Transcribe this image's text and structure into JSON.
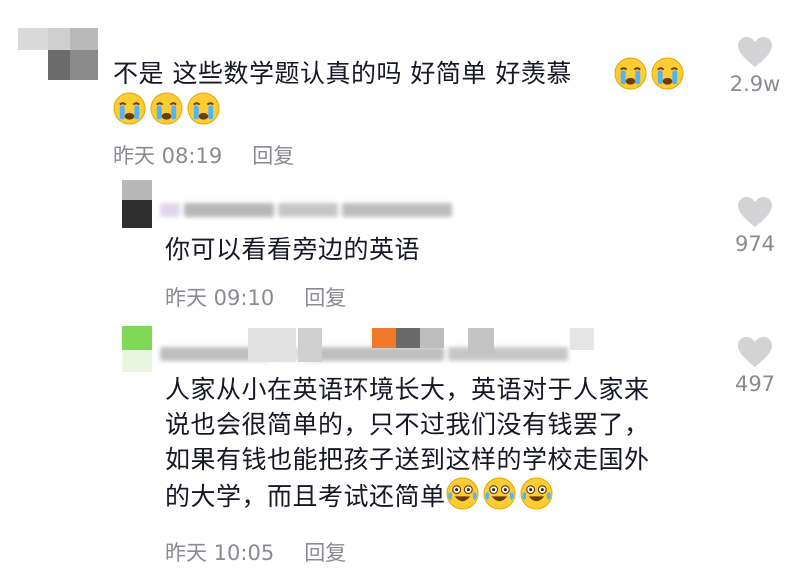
{
  "comments": [
    {
      "text_line1": "不是 这些数学题认真的吗 好简单 好羡慕",
      "time": "昨天 08:19",
      "reply_label": "回复",
      "likes": "2.9w",
      "emoji_name": "crying-face",
      "emoji_count": 5
    },
    {
      "text": "你可以看看旁边的英语",
      "time": "昨天 09:10",
      "reply_label": "回复",
      "likes": "974"
    },
    {
      "lines": [
        "人家从小在英语环境长大，英语对于人家来",
        "说也会很简单的，只不过我们没有钱罢了，",
        "如果有钱也能把孩子送到这样的学校走国外",
        "的大学，而且考试还简单"
      ],
      "time": "昨天 10:05",
      "reply_label": "回复",
      "likes": "497",
      "emoji_name": "crying-laughing-face",
      "emoji_count": 3
    }
  ],
  "colors": {
    "text": "#161823",
    "meta": "#8a8b91",
    "heart": "#d3d3d6"
  }
}
